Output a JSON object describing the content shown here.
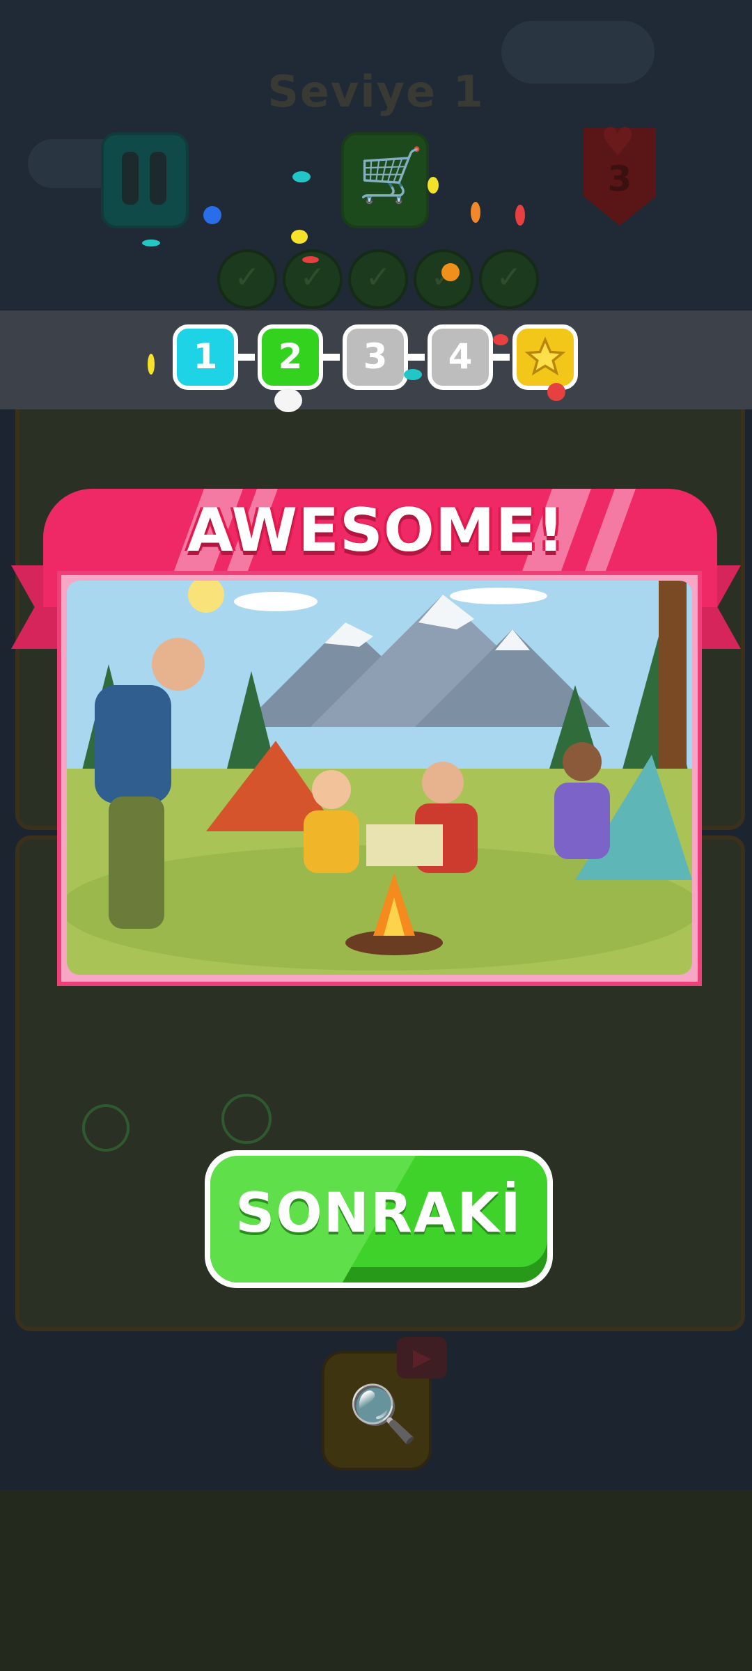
{
  "header": {
    "level_title": "Seviye 1",
    "lives": "3"
  },
  "progress": {
    "steps": [
      {
        "label": "1",
        "state": "done",
        "color": "#1fd3e6"
      },
      {
        "label": "2",
        "state": "current",
        "color": "#33d21f"
      },
      {
        "label": "3",
        "state": "locked",
        "color": "#bdbdbd"
      },
      {
        "label": "4",
        "state": "locked",
        "color": "#bdbdbd"
      },
      {
        "label": "star",
        "state": "reward",
        "color": "#f3c61a"
      }
    ],
    "found_marks": 5
  },
  "result": {
    "banner_text": "AWESOME!",
    "next_button": "SONRAKİ"
  },
  "colors": {
    "banner": "#ef2866",
    "next_button": "#3fd22a",
    "overlay": "#1c2430"
  },
  "icons": [
    "pause-icon",
    "cart-icon",
    "heart-icon",
    "check-icon",
    "star-icon",
    "magnifier-icon",
    "video-icon"
  ]
}
